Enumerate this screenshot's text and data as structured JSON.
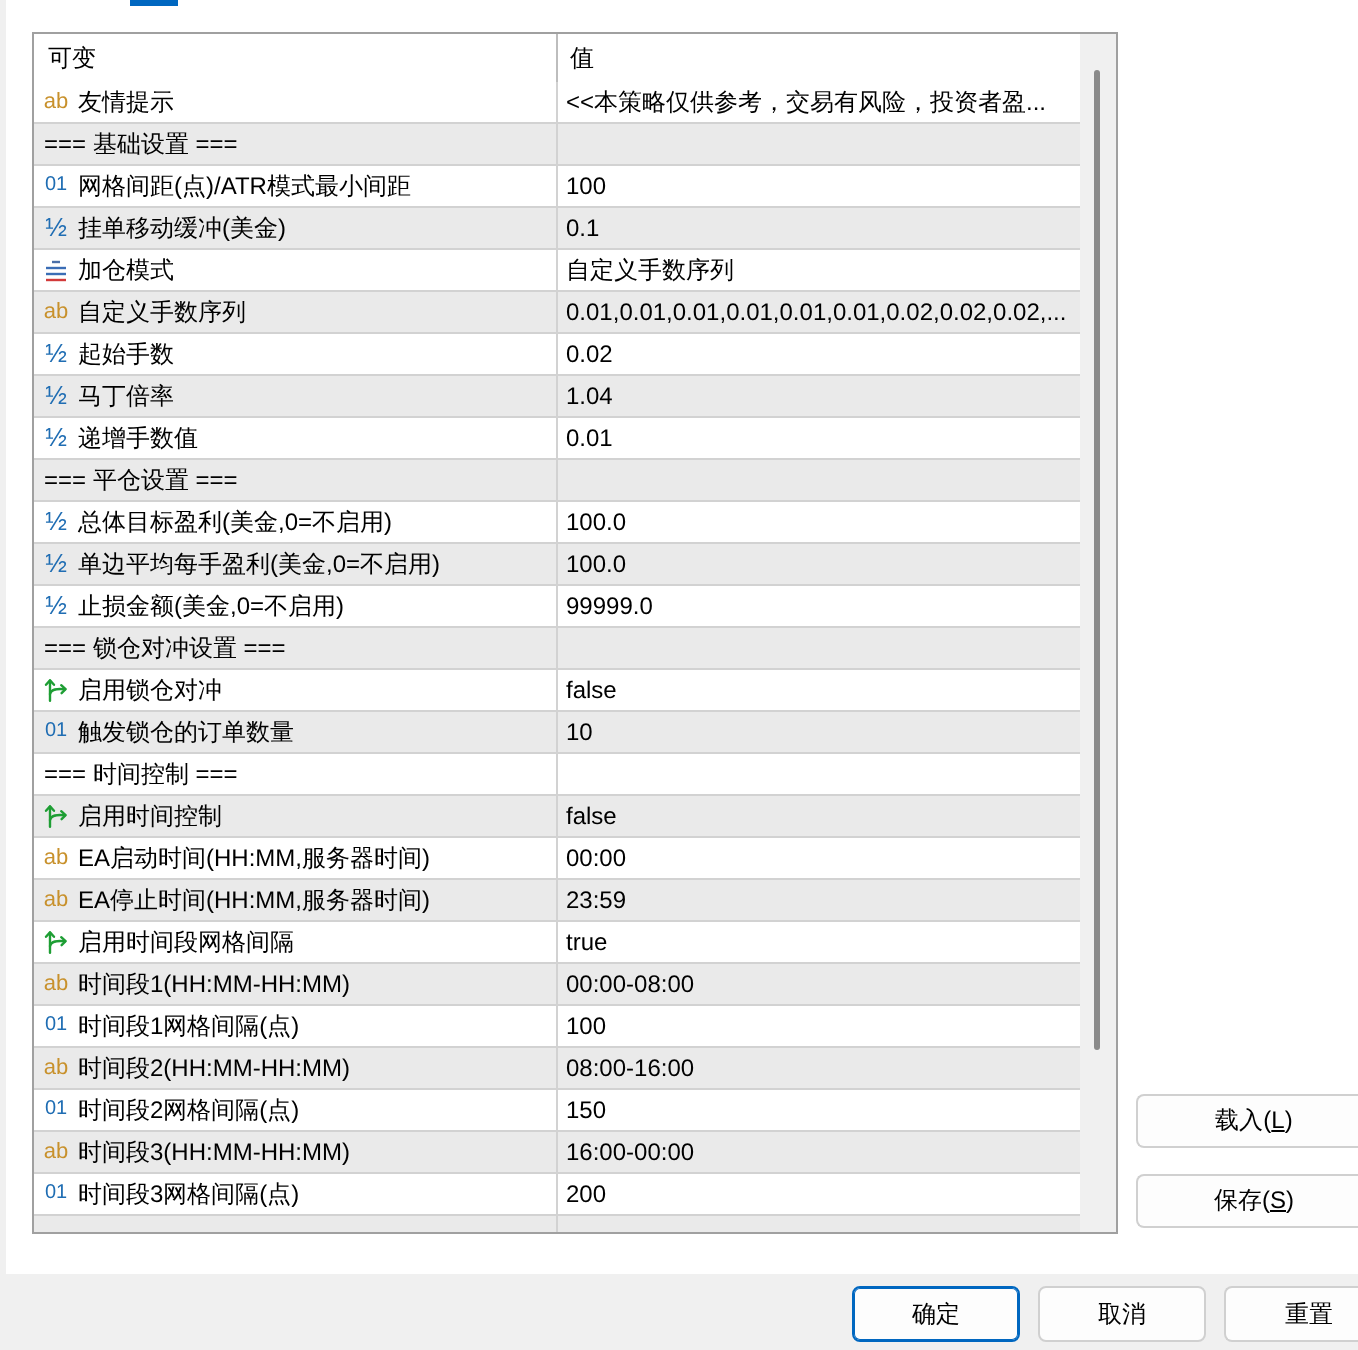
{
  "tabs": [
    {
      "selected": true
    }
  ],
  "table": {
    "columns": [
      "可变",
      "值"
    ],
    "rows": [
      {
        "kind": "string",
        "icon": "ab",
        "name": "友情提示",
        "value": "<<本策略仅供参考，交易有风险，投资者盈..."
      },
      {
        "kind": "section",
        "name": "=== 基础设置 ==="
      },
      {
        "kind": "int",
        "icon": "01",
        "name": "网格间距(点)/ATR模式最小间距",
        "value": "100"
      },
      {
        "kind": "double",
        "icon": "½",
        "name": "挂单移动缓冲(美金)",
        "value": "0.1"
      },
      {
        "kind": "enum",
        "name": "加仓模式",
        "value": "自定义手数序列"
      },
      {
        "kind": "string",
        "icon": "ab",
        "name": "自定义手数序列",
        "value": "0.01,0.01,0.01,0.01,0.01,0.01,0.02,0.02,0.02,..."
      },
      {
        "kind": "double",
        "icon": "½",
        "name": "起始手数",
        "value": "0.02"
      },
      {
        "kind": "double",
        "icon": "½",
        "name": "马丁倍率",
        "value": "1.04"
      },
      {
        "kind": "double",
        "icon": "½",
        "name": "递增手数值",
        "value": "0.01"
      },
      {
        "kind": "section",
        "name": "=== 平仓设置 ==="
      },
      {
        "kind": "double",
        "icon": "½",
        "name": "总体目标盈利(美金,0=不启用)",
        "value": "100.0"
      },
      {
        "kind": "double",
        "icon": "½",
        "name": "单边平均每手盈利(美金,0=不启用)",
        "value": "100.0"
      },
      {
        "kind": "double",
        "icon": "½",
        "name": "止损金额(美金,0=不启用)",
        "value": "99999.0"
      },
      {
        "kind": "section",
        "name": "=== 锁仓对冲设置 ==="
      },
      {
        "kind": "bool",
        "name": "启用锁仓对冲",
        "value": "false"
      },
      {
        "kind": "int",
        "icon": "01",
        "name": "触发锁仓的订单数量",
        "value": "10"
      },
      {
        "kind": "section",
        "name": "=== 时间控制 ==="
      },
      {
        "kind": "bool",
        "name": "启用时间控制",
        "value": "false"
      },
      {
        "kind": "string",
        "icon": "ab",
        "name": "EA启动时间(HH:MM,服务器时间)",
        "value": "00:00"
      },
      {
        "kind": "string",
        "icon": "ab",
        "name": "EA停止时间(HH:MM,服务器时间)",
        "value": "23:59"
      },
      {
        "kind": "bool",
        "name": "启用时间段网格间隔",
        "value": "true"
      },
      {
        "kind": "string",
        "icon": "ab",
        "name": "时间段1(HH:MM-HH:MM)",
        "value": "00:00-08:00"
      },
      {
        "kind": "int",
        "icon": "01",
        "name": "时间段1网格间隔(点)",
        "value": "100"
      },
      {
        "kind": "string",
        "icon": "ab",
        "name": "时间段2(HH:MM-HH:MM)",
        "value": "08:00-16:00"
      },
      {
        "kind": "int",
        "icon": "01",
        "name": "时间段2网格间隔(点)",
        "value": "150"
      },
      {
        "kind": "string",
        "icon": "ab",
        "name": "时间段3(HH:MM-HH:MM)",
        "value": "16:00-00:00"
      },
      {
        "kind": "int",
        "icon": "01",
        "name": "时间段3网格间隔(点)",
        "value": "200"
      }
    ]
  },
  "side_buttons": [
    {
      "label": "载入(",
      "access_key": "L",
      "label_end": ")"
    },
    {
      "label": "保存(",
      "access_key": "S",
      "label_end": ")"
    }
  ],
  "dialog_buttons": [
    {
      "label": "确定",
      "default": true
    },
    {
      "label": "取消",
      "default": false
    },
    {
      "label": "重置",
      "default": false
    }
  ]
}
